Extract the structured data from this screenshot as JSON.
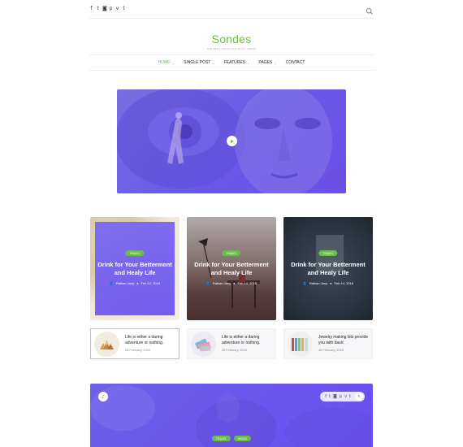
{
  "topbar": {
    "social_icons": [
      "facebook-icon",
      "twitter-icon",
      "instagram-icon",
      "pinterest-icon",
      "vimeo-icon",
      "tumblr-icon"
    ],
    "social_glyphs": [
      "f",
      "t",
      "◙",
      "p",
      "v",
      "t"
    ]
  },
  "logo": {
    "name": "Sondes",
    "tagline": "THE BEST TRAVELING BLOG THEME"
  },
  "nav": {
    "items": [
      {
        "label": "HOME",
        "active": true,
        "dropdown": true
      },
      {
        "label": "SINGLE POST",
        "active": false,
        "dropdown": true
      },
      {
        "label": "FEATURES",
        "active": false,
        "dropdown": true
      },
      {
        "label": "PAGES",
        "active": false,
        "dropdown": true
      },
      {
        "label": "CONTACT",
        "active": false,
        "dropdown": false
      }
    ]
  },
  "hero": {
    "icon": "play-icon"
  },
  "cards": [
    {
      "badge": "TRAVEL",
      "title": "Drink for Your Betterment and Healy Life",
      "author": "Rafsan Jany",
      "date": "Feb 14, 2018"
    },
    {
      "badge": "TRAVEL",
      "title": "Drink for Your Betterment and Healy Life",
      "author": "Rafsan Jany",
      "date": "Feb 14, 2018"
    },
    {
      "badge": "TRAVEL",
      "title": "Drink for Your Betterment and Healy Life",
      "author": "Rafsan Jany",
      "date": "Feb 14, 2018"
    }
  ],
  "mini_posts": [
    {
      "title": "Life is either a daring adventure or nothing.",
      "date": "28 February, 2018"
    },
    {
      "title": "Life is either a daring adventure or nothing.",
      "date": "28 February, 2018"
    },
    {
      "title": "Jewelry making kits provide you with basic",
      "date": "28 February, 2018"
    }
  ],
  "hero2": {
    "tags": [
      "TRAVEL",
      "MUSIC"
    ],
    "share_icons": [
      "facebook-icon",
      "twitter-icon",
      "instagram-icon",
      "pinterest-icon",
      "vimeo-icon",
      "tumblr-icon"
    ],
    "share_glyphs": [
      "f",
      "t",
      "◙",
      "p",
      "v",
      "t"
    ]
  },
  "colors": {
    "accent": "#6abd45",
    "purple": "#6a5ae8"
  }
}
